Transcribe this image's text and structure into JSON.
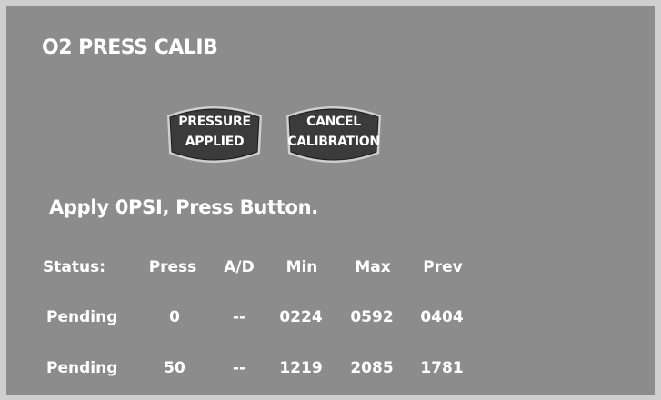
{
  "screen": {
    "title": "O2 PRESS CALIB",
    "instruction": "Apply 0PSI, Press Button."
  },
  "buttons": {
    "pressure_applied": {
      "line1": "PRESSURE",
      "line2": "APPLIED"
    },
    "cancel_calibration": {
      "line1": "CANCEL",
      "line2": "CALIBRATION"
    }
  },
  "table": {
    "headers": [
      "Status:",
      "Press",
      "A/D",
      "Min",
      "Max",
      "Prev"
    ],
    "rows": [
      [
        "Pending",
        "0",
        "--",
        "0224",
        "0592",
        "0404"
      ],
      [
        "Pending",
        "50",
        "--",
        "1219",
        "2085",
        "1781"
      ]
    ]
  },
  "colors": {
    "background": "#8c8c8c",
    "button_face": "#3b3b3b",
    "text": "#ffffff",
    "border": "#cfcfcf"
  }
}
